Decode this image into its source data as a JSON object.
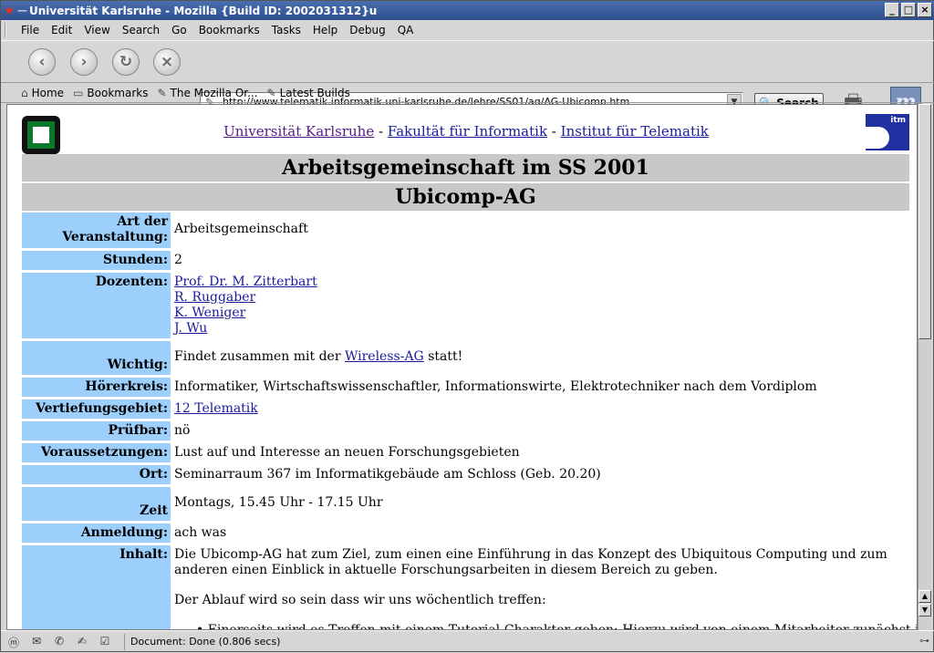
{
  "window": {
    "title": "Universität Karlsruhe - Mozilla {Build ID: 2002031312}u"
  },
  "menu": [
    "File",
    "Edit",
    "View",
    "Search",
    "Go",
    "Bookmarks",
    "Tasks",
    "Help",
    "Debug",
    "QA"
  ],
  "navigation": {
    "url": "http://www.telematik.informatik.uni-karlsruhe.de/lehre/SS01/ag/AG-Ubicomp.htm",
    "search_label": "Search"
  },
  "personal_toolbar": [
    "Home",
    "Bookmarks",
    "The Mozilla Or...",
    "Latest Builds"
  ],
  "page": {
    "links": {
      "uni": "Universität Karlsruhe",
      "sep1": " - ",
      "fak": "Fakultät für Informatik",
      "sep2": " - ",
      "inst": "Institut für Telematik"
    },
    "logo_text": "itm",
    "heading1": "Arbeitsgemeinschaft im SS 2001",
    "heading2": "Ubicomp-AG",
    "rows": {
      "art": {
        "label1": "Art der",
        "label2": "Veranstaltung:",
        "value": "Arbeitsgemeinschaft"
      },
      "stunden": {
        "label": "Stunden:",
        "value": "2"
      },
      "dozenten": {
        "label": "Dozenten:",
        "values": [
          "Prof. Dr. M. Zitterbart",
          "R. Ruggaber",
          "K. Weniger",
          "J. Wu"
        ]
      },
      "wichtig": {
        "label": "Wichtig:",
        "pre": "Findet zusammen mit der ",
        "link": "Wireless-AG",
        "post": " statt!"
      },
      "hoererkreis": {
        "label": "Hörerkreis:",
        "value": "Informatiker, Wirtschaftswissenschaftler, Informationswirte, Elektrotechniker nach dem Vordiplom"
      },
      "vertiefung": {
        "label": "Vertiefungsgebiet:",
        "value": "12 Telematik"
      },
      "pruefbar": {
        "label": "Prüfbar:",
        "value": "nö"
      },
      "voraussetzungen": {
        "label": "Voraussetzungen:",
        "value": "Lust auf und Interesse an neuen Forschungsgebieten"
      },
      "ort": {
        "label": "Ort:",
        "value": "Seminarraum 367 im Informatikgebäude am Schloss (Geb. 20.20)"
      },
      "zeit": {
        "label": "Zeit",
        "value": "Montags, 15.45 Uhr - 17.15 Uhr"
      },
      "anmeldung": {
        "label": "Anmeldung:",
        "value": "ach was"
      },
      "inhalt": {
        "label": "Inhalt:",
        "p1": "Die Ubicomp-AG hat zum Ziel, zum einen eine Einführung in das Konzept des Ubiquitous Computing und zum anderen einen Einblick in aktuelle Forschungsarbeiten in diesem Bereich zu geben.",
        "p2": "Der Ablauf wird so sein dass wir uns wöchentlich treffen:",
        "li1": "Einerseits wird es Treffen mit einem Tutorial-Charakter geben: Hierzu wird von einem Mitarbeiter zunächst in"
      }
    }
  },
  "status": {
    "text": "Document: Done (0.806 secs)"
  }
}
